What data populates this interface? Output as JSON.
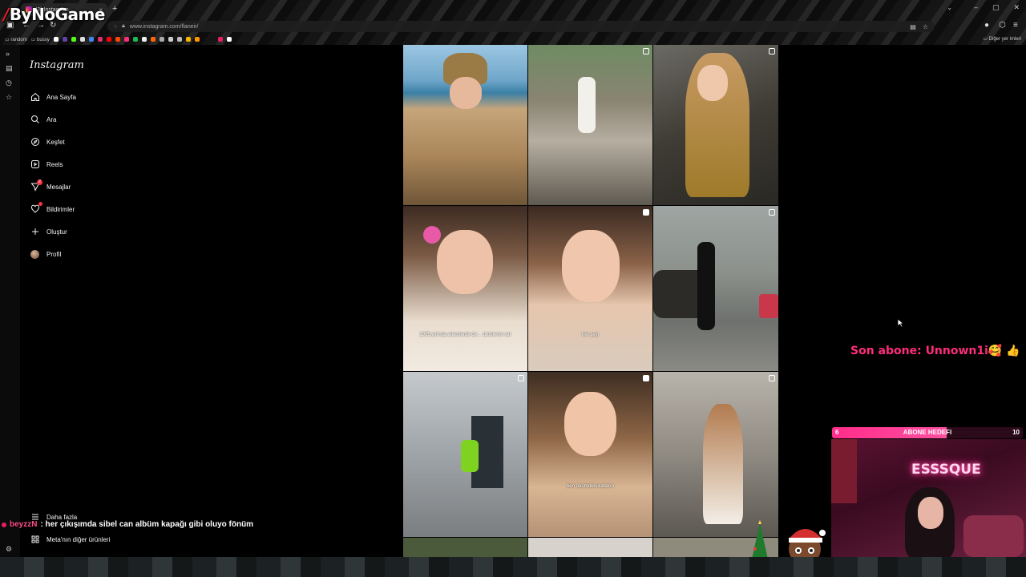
{
  "browser": {
    "tab_title": "(2) Instagram",
    "new_tab_icon": "plus-icon",
    "url": "www.instagram.com/flaneir/",
    "bookmarks": [
      "random",
      "bussy"
    ],
    "other_bookmarks": "Diğer yer imleri"
  },
  "stream": {
    "logo": "ByNoGame",
    "sub_alert": "Son abone: Unnown1i🥰 👍",
    "chat": {
      "user": "beyzzN",
      "message": ": her çıkışımda sibel can albüm kapağı gibi oluyo fönüm"
    },
    "sub_goal": {
      "label": "ABONE HEDEFI",
      "current": "6",
      "target": "10",
      "progress": 0.6
    },
    "neon_sign": "ESSSQUE"
  },
  "instagram": {
    "logo": "Instagram",
    "nav": [
      {
        "label": "Ana Sayfa",
        "icon": "home-icon"
      },
      {
        "label": "Ara",
        "icon": "search-icon"
      },
      {
        "label": "Keşfet",
        "icon": "compass-icon"
      },
      {
        "label": "Reels",
        "icon": "reels-icon"
      },
      {
        "label": "Mesajlar",
        "icon": "messenger-icon",
        "badge": "2"
      },
      {
        "label": "Bildirimler",
        "icon": "heart-icon"
      },
      {
        "label": "Oluştur",
        "icon": "plus-icon"
      },
      {
        "label": "Profil",
        "icon": "avatar"
      }
    ],
    "more": "Daha fazla",
    "meta": "Meta'nın diğer ürünleri",
    "captions": {
      "post_4": "1995 yılı'nda ailemlerde de… ürünlerim var",
      "post_5": "her şeyi",
      "post_8": "ben önümdeki katların"
    }
  }
}
